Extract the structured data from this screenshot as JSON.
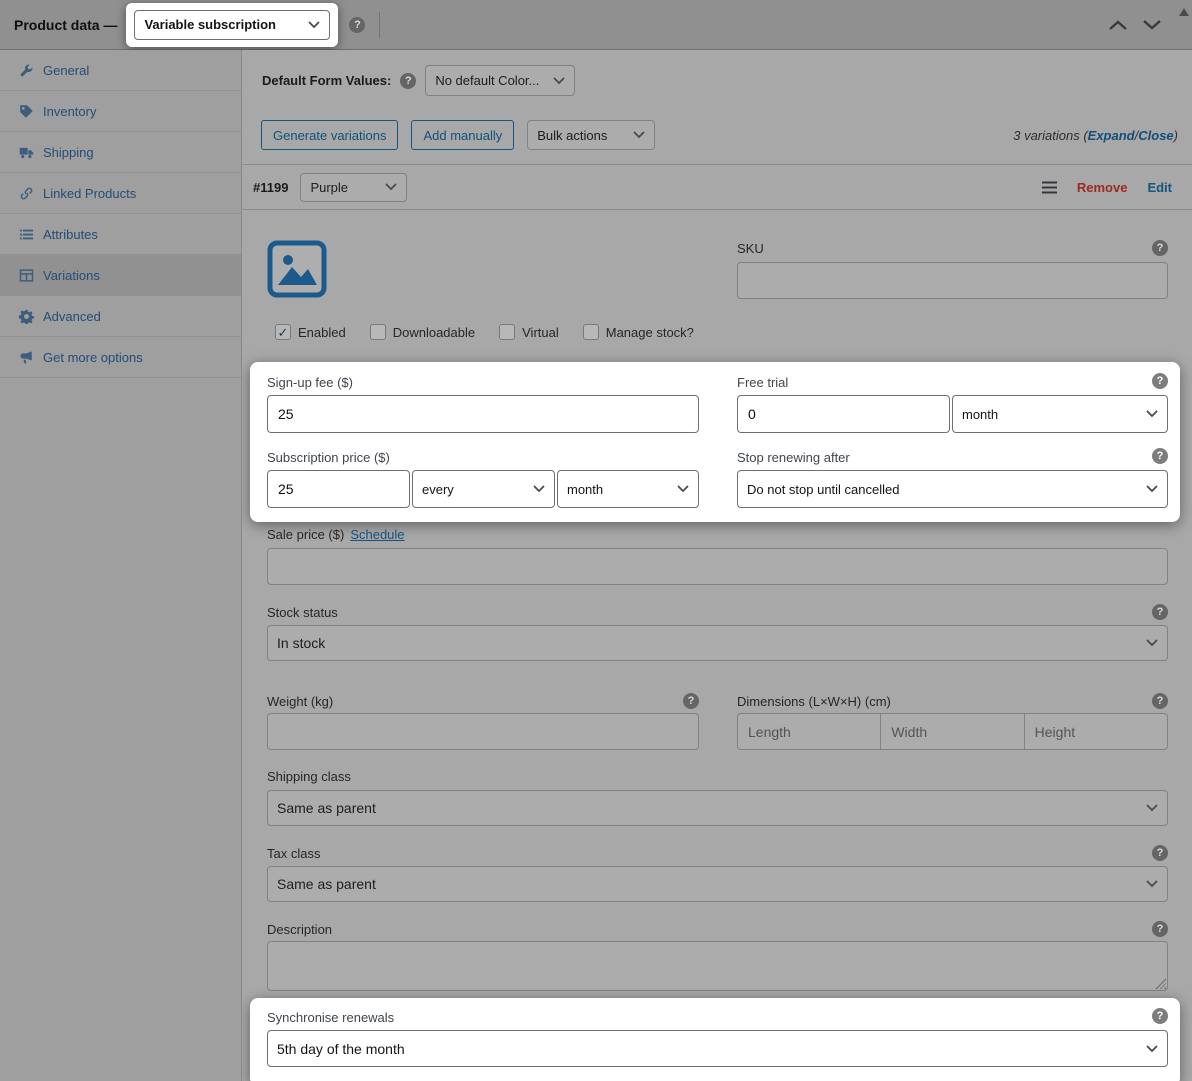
{
  "icons": {
    "help": "?"
  },
  "header": {
    "title": "Product data —",
    "product_type_select": "Variable subscription"
  },
  "sidebar": {
    "items": [
      {
        "label": "General"
      },
      {
        "label": "Inventory"
      },
      {
        "label": "Shipping"
      },
      {
        "label": "Linked Products"
      },
      {
        "label": "Attributes"
      },
      {
        "label": "Variations"
      },
      {
        "label": "Advanced"
      },
      {
        "label": "Get more options"
      }
    ]
  },
  "defaults_row": {
    "label": "Default Form Values:",
    "color_select": "No default Color..."
  },
  "toolbar": {
    "generate_variations": "Generate variations",
    "add_manually": "Add manually",
    "bulk_actions": "Bulk actions",
    "summary_prefix": "3 variations (",
    "expand_link": "Expand",
    "separator": " / ",
    "close_link": "Close",
    "summary_suffix": ")"
  },
  "variation": {
    "id": "#1199",
    "attribute_select": "Purple",
    "remove_label": "Remove",
    "edit_label": "Edit",
    "sku": {
      "label": "SKU",
      "value": ""
    },
    "checkboxes": [
      {
        "label": "Enabled",
        "checked": true
      },
      {
        "label": "Downloadable",
        "checked": false
      },
      {
        "label": "Virtual",
        "checked": false
      },
      {
        "label": "Manage stock?",
        "checked": false
      }
    ],
    "signup_fee": {
      "label": "Sign-up fee ($)",
      "value": "25"
    },
    "free_trial": {
      "label": "Free trial",
      "value": "0",
      "period_select": "month"
    },
    "subscription_price": {
      "label": "Subscription price ($)",
      "value": "25",
      "interval_select": "every",
      "period_select": "month"
    },
    "stop_renewing": {
      "label": "Stop renewing after",
      "select": "Do not stop until cancelled"
    },
    "sale_price": {
      "label": "Sale price ($)",
      "schedule_link": "Schedule",
      "value": ""
    },
    "stock_status": {
      "label": "Stock status",
      "select": "In stock"
    },
    "weight": {
      "label": "Weight (kg)",
      "value": ""
    },
    "dimensions": {
      "label": "Dimensions (L×W×H) (cm)",
      "length_placeholder": "Length",
      "width_placeholder": "Width",
      "height_placeholder": "Height"
    },
    "shipping_class": {
      "label": "Shipping class",
      "select": "Same as parent"
    },
    "tax_class": {
      "label": "Tax class",
      "select": "Same as parent"
    },
    "description": {
      "label": "Description",
      "value": ""
    },
    "synchronise_renewals": {
      "label": "Synchronise renewals",
      "select": "5th day of the month"
    }
  },
  "colors": {
    "accent_blue": "#2271b1",
    "dimmed_blue": "#14557f",
    "remove_red": "#9c2a24",
    "highlight_bg": "#ffffff"
  }
}
